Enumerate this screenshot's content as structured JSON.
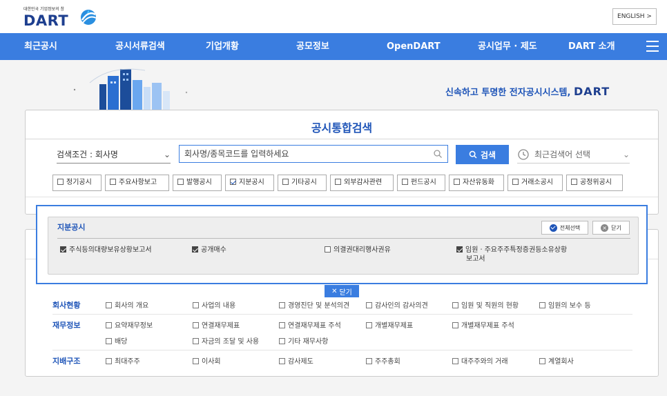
{
  "header": {
    "logo_subtitle": "대한민국 기업정보의 창",
    "logo_text": "DART",
    "language_button": "ENGLISH >"
  },
  "nav": {
    "items": [
      "최근공시",
      "공시서류검색",
      "기업개황",
      "공모정보",
      "OpenDART",
      "공시업무 · 제도",
      "DART 소개"
    ]
  },
  "hero": {
    "slogan": "신속하고 투명한 전자공시시스템,",
    "slogan_brand": "DART"
  },
  "search": {
    "title": "공시통합검색",
    "condition": "검색조건 : 회사명",
    "input_placeholder": "회사명/종목코드를 입력하세요",
    "search_button": "검색",
    "recent_label": "최근검색어 선택",
    "tabs": [
      {
        "label": "정기공시",
        "checked": false
      },
      {
        "label": "주요사항보고",
        "checked": false
      },
      {
        "label": "발행공시",
        "checked": false
      },
      {
        "label": "지분공시",
        "checked": true
      },
      {
        "label": "기타공시",
        "checked": false
      },
      {
        "label": "외부감사관련",
        "checked": false
      },
      {
        "label": "펀드공시",
        "checked": false
      },
      {
        "label": "자산유동화",
        "checked": false
      },
      {
        "label": "거래소공시",
        "checked": false
      },
      {
        "label": "공정위공시",
        "checked": false
      }
    ]
  },
  "popup": {
    "title": "지분공시",
    "select_all": "전체선택",
    "close": "닫기",
    "options": [
      {
        "label": "주식등의대량보유상황보고서",
        "checked": true
      },
      {
        "label": "공개매수",
        "checked": true
      },
      {
        "label": "의결권대리행사권유",
        "checked": false
      },
      {
        "label": "임원ㆍ주요주주특정증권등소유상황",
        "label2": "보고서",
        "checked": true
      }
    ],
    "close_tab": "닫기"
  },
  "details": {
    "groups": [
      {
        "name": "회사현황",
        "items": [
          "회사의 개요",
          "사업의 내용",
          "경영진단 및 분석의견",
          "감사인의 감사의견",
          "임원 및 직원의 현황",
          "임원의 보수 등"
        ]
      },
      {
        "name": "재무정보",
        "items": [
          "요약재무정보",
          "연결재무제표",
          "연결재무제표 주석",
          "개별재무제표",
          "개별재무제표 주석",
          "배당",
          "자금의 조달 및 사용",
          "기타 재무사항"
        ]
      },
      {
        "name": "지배구조",
        "items": [
          "최대주주",
          "이사회",
          "감사제도",
          "주주총회",
          "대주주와의 거래",
          "계열회사"
        ]
      }
    ]
  },
  "colors": {
    "brand_blue": "#3a7de0",
    "title_blue": "#1f55b8",
    "logo_navy": "#1e3f8f"
  }
}
